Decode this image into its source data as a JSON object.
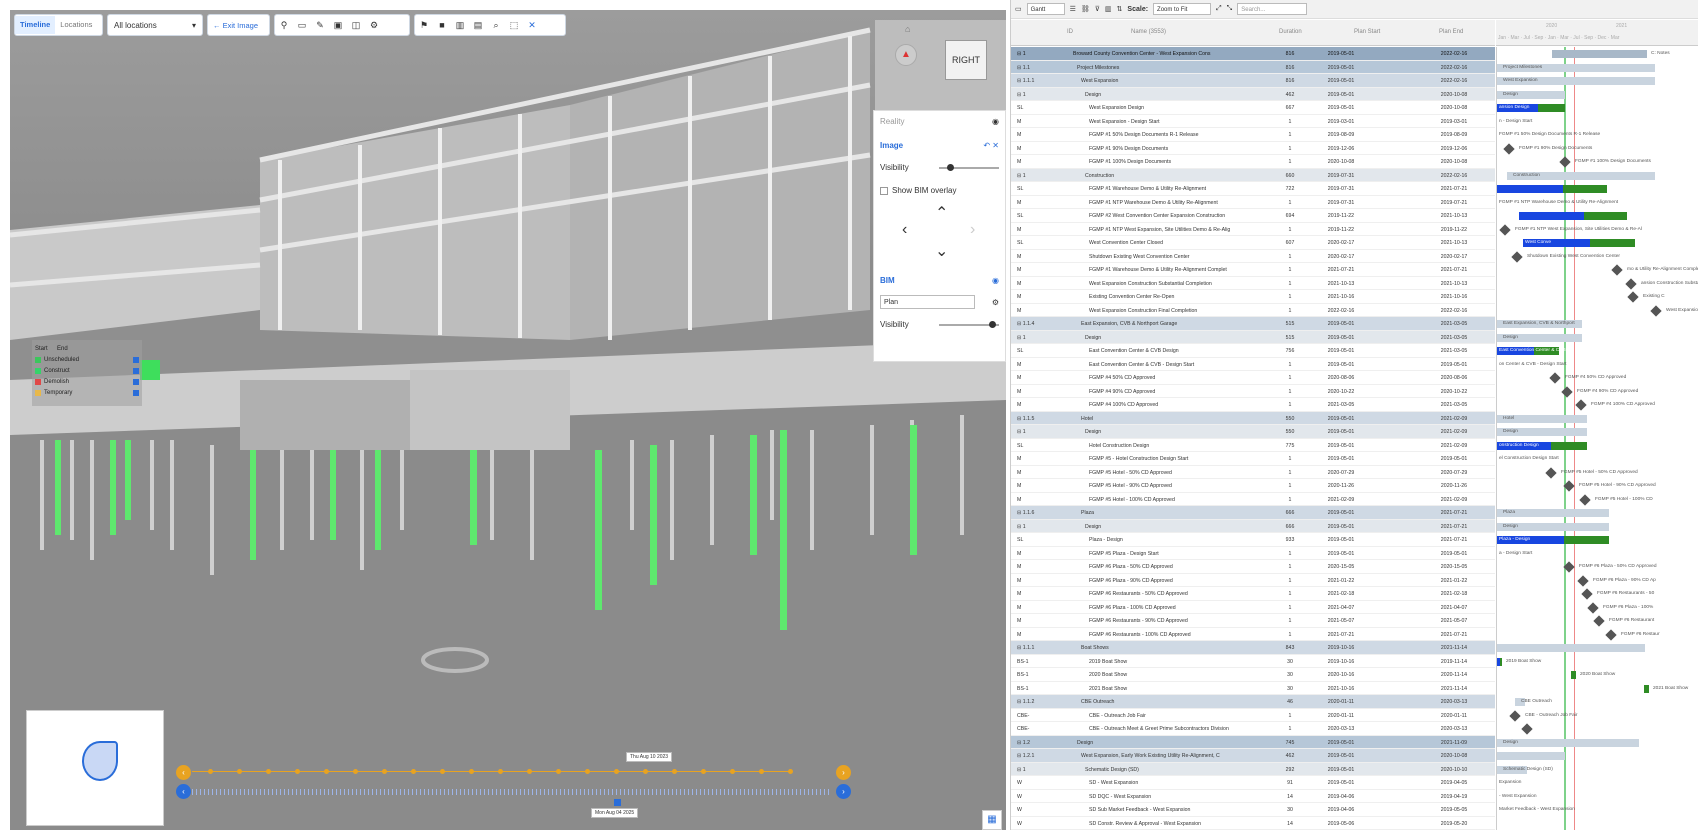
{
  "viewer": {
    "tabs": [
      {
        "label": "Timeline",
        "active": true
      },
      {
        "label": "Locations",
        "active": false
      }
    ],
    "location_select": "All locations",
    "exit_image": "Exit Image",
    "nav_cube_label": "RIGHT",
    "panel": {
      "reality": "Reality",
      "image": "Image",
      "visibility": "Visibility",
      "show_bim_overlay": "Show BIM overlay",
      "bim": "BIM",
      "plan_select": "Plan",
      "visibility2": "Visibility"
    },
    "legend": {
      "start": "Start",
      "end": "End",
      "items": [
        {
          "label": "Unscheduled",
          "color": "#3cc65c"
        },
        {
          "label": "Construct",
          "color": "#36d36a"
        },
        {
          "label": "Demolish",
          "color": "#e04848"
        },
        {
          "label": "Temporary",
          "color": "#e8b84a"
        }
      ]
    },
    "timeline": {
      "top_date": "Thu Aug 10 2023",
      "bottom_date": "Mon Aug 04 2025"
    }
  },
  "gantt": {
    "toolbar": {
      "view": "Gantt",
      "scale_label": "Scale:",
      "scale_value": "Zoom to Fit",
      "search_placeholder": "Search..."
    },
    "columns": {
      "id": "ID",
      "name": "Name (3553)",
      "duration": "Duration",
      "plan_start": "Plan Start",
      "plan_end": "Plan End"
    },
    "years": [
      "2020",
      "2021"
    ],
    "months": "Jan · Mar · Jul · Sep · Jan · Mar · Jul · Sep · Dec · Mar",
    "rows": [
      {
        "s": 0,
        "id": "⊟ 1",
        "name": "Broward County Convention Center - West Expansion Cons",
        "dur": "816",
        "ps": "2019-05-01",
        "pe": "2022-02-16",
        "bar": {
          "t": "pbar",
          "a": 55,
          "b": 150
        },
        "txt": "C: Notes"
      },
      {
        "s": 1,
        "id": "⊟ 1.1",
        "name": "Project Milestones",
        "dur": "816",
        "ps": "2019-05-01",
        "pe": "2022-02-16",
        "bar": {
          "t": "sum",
          "a": 0,
          "b": 158
        },
        "txt": "Project Milestones"
      },
      {
        "s": 2,
        "id": "⊟ 1.1.1",
        "name": "West Expansion",
        "dur": "816",
        "ps": "2019-05-01",
        "pe": "2022-02-16",
        "bar": {
          "t": "sum",
          "a": 0,
          "b": 158
        },
        "txt": "West Expansion"
      },
      {
        "s": 3,
        "id": "⊟ 1",
        "name": "Design",
        "dur": "462",
        "ps": "2019-05-01",
        "pe": "2020-10-08",
        "bar": {
          "t": "sum",
          "a": 0,
          "b": 68
        },
        "txt": "Design"
      },
      {
        "s": 4,
        "id": "SL",
        "name": "West Expansion Design",
        "dur": "667",
        "ps": "2019-05-01",
        "pe": "2020-10-08",
        "bar": {
          "t": "blue",
          "a": 0,
          "b": 68
        },
        "txt": "ansion Design"
      },
      {
        "s": 4,
        "id": "M",
        "name": "West Expansion - Design Start",
        "dur": "1",
        "ps": "2019-03-01",
        "pe": "2019-03-01",
        "txt": "n - Design Start"
      },
      {
        "s": 4,
        "id": "M",
        "name": "FGMP #1 50% Design Documents R-1 Release",
        "dur": "1",
        "ps": "2019-08-09",
        "pe": "2019-08-09",
        "txt": "FGMP #1 50% Design Documents R-1 Release"
      },
      {
        "s": 4,
        "id": "M",
        "name": "FGMP #1 90% Design Documents",
        "dur": "1",
        "ps": "2019-12-06",
        "pe": "2019-12-06",
        "dia": 8,
        "txt": "FGMP #1 90% Design Documents"
      },
      {
        "s": 4,
        "id": "M",
        "name": "FGMP #1 100% Design Documents",
        "dur": "1",
        "ps": "2020-10-08",
        "pe": "2020-10-08",
        "dia": 64,
        "txt": "FGMP #1 100% Design Documents"
      },
      {
        "s": 3,
        "id": "⊟ 1",
        "name": "Construction",
        "dur": "660",
        "ps": "2019-07-31",
        "pe": "2022-02-16",
        "bar": {
          "t": "sum",
          "a": 10,
          "b": 158
        },
        "txt": "Construction"
      },
      {
        "s": 4,
        "id": "SL",
        "name": "FGMP #1 Warehouse Demo & Utility Re-Alignment",
        "dur": "722",
        "ps": "2019-07-31",
        "pe": "2021-07-21",
        "bar": {
          "t": "blue",
          "a": 0,
          "b": 110
        }
      },
      {
        "s": 4,
        "id": "M",
        "name": "FGMP #1 NTP Warehouse Demo & Utility Re-Alignment",
        "dur": "1",
        "ps": "2019-07-31",
        "pe": "2019-07-21",
        "txt": "FGMP #1 NTP Warehouse Demo & Utility Re-Alignment"
      },
      {
        "s": 4,
        "id": "SL",
        "name": "FGMP #2 West Convention Center Expansion Construction",
        "dur": "694",
        "ps": "2019-11-22",
        "pe": "2021-10-13",
        "bar": {
          "t": "blue",
          "a": 22,
          "b": 130
        }
      },
      {
        "s": 4,
        "id": "M",
        "name": "FGMP #1 NTP West Expansion, Site Utilities Demo & Re-Alig",
        "dur": "1",
        "ps": "2019-11-22",
        "pe": "2019-11-22",
        "dia": 4,
        "txt": "FGMP #1 NTP West Expansion, Site Utilities Demo & Re-Al"
      },
      {
        "s": 4,
        "id": "SL",
        "name": "West Convention Center Closed",
        "dur": "607",
        "ps": "2020-02-17",
        "pe": "2021-10-13",
        "bar": {
          "t": "blue",
          "a": 26,
          "b": 138
        },
        "txt": "West Conve"
      },
      {
        "s": 4,
        "id": "M",
        "name": "Shutdown Existing West Convention Center",
        "dur": "1",
        "ps": "2020-02-17",
        "pe": "2020-02-17",
        "dia": 16,
        "txt": "Shutdown Existing West Convention Center"
      },
      {
        "s": 4,
        "id": "M",
        "name": "FGMP #1 Warehouse Demo & Utility Re-Alignment Complet",
        "dur": "1",
        "ps": "2021-07-21",
        "pe": "2021-07-21",
        "dia": 116,
        "txt": "mo & Utility Re-Alignment Complete"
      },
      {
        "s": 4,
        "id": "M",
        "name": "West Expansion Construction Substantial Completion",
        "dur": "1",
        "ps": "2021-10-13",
        "pe": "2021-10-13",
        "dia": 130,
        "txt": "ansion Construction Substantial Completion"
      },
      {
        "s": 4,
        "id": "M",
        "name": "Existing Convention Center Re-Open",
        "dur": "1",
        "ps": "2021-10-16",
        "pe": "2021-10-16",
        "dia": 132,
        "txt": "Existing C"
      },
      {
        "s": 4,
        "id": "M",
        "name": "West Expansion Construction Final Completion",
        "dur": "1",
        "ps": "2022-02-16",
        "pe": "2022-02-16",
        "dia": 155,
        "txt": "West Expansion Construction Final Completion"
      },
      {
        "s": 2,
        "id": "⊟ 1.1.4",
        "name": "East Expansion, CVB & Northport Garage",
        "dur": "515",
        "ps": "2019-05-01",
        "pe": "2021-03-05",
        "bar": {
          "t": "sum",
          "a": 0,
          "b": 85
        },
        "txt": "East Expansion, CVB & Northport"
      },
      {
        "s": 3,
        "id": "⊟ 1",
        "name": "Design",
        "dur": "515",
        "ps": "2019-05-01",
        "pe": "2021-03-05",
        "bar": {
          "t": "sum",
          "a": 0,
          "b": 85
        },
        "txt": "Design"
      },
      {
        "s": 4,
        "id": "SL",
        "name": "East Convention Center & CVB Design",
        "dur": "756",
        "ps": "2019-05-01",
        "pe": "2021-03-05",
        "bar": {
          "t": "blue",
          "a": 0,
          "b": 62
        },
        "txt": "East Convention Center & CVB"
      },
      {
        "s": 4,
        "id": "M",
        "name": "East Convention Center & CVB - Design Start",
        "dur": "1",
        "ps": "2019-05-01",
        "pe": "2019-05-01",
        "txt": "on Center & CVB - Design Start"
      },
      {
        "s": 4,
        "id": "M",
        "name": "FGMP #4 50% CD Approved",
        "dur": "1",
        "ps": "2020-08-06",
        "pe": "2020-08-06",
        "dia": 54,
        "txt": "FGMP #4 50% CD Approved"
      },
      {
        "s": 4,
        "id": "M",
        "name": "FGMP #4 90% CD Approved",
        "dur": "1",
        "ps": "2020-10-22",
        "pe": "2020-10-22",
        "dia": 66,
        "txt": "FGMP #4 90% CD Approved"
      },
      {
        "s": 4,
        "id": "M",
        "name": "FGMP #4 100% CD Approved",
        "dur": "1",
        "ps": "2021-03-05",
        "pe": "2021-03-05",
        "dia": 80,
        "txt": "FGMP #4 100% CD Approved"
      },
      {
        "s": 2,
        "id": "⊟ 1.1.5",
        "name": "Hotel",
        "dur": "550",
        "ps": "2019-05-01",
        "pe": "2021-02-09",
        "bar": {
          "t": "sum",
          "a": 0,
          "b": 90
        },
        "txt": "Hotel"
      },
      {
        "s": 3,
        "id": "⊟ 1",
        "name": "Design",
        "dur": "550",
        "ps": "2019-05-01",
        "pe": "2021-02-09",
        "bar": {
          "t": "sum",
          "a": 0,
          "b": 90
        },
        "txt": "Design"
      },
      {
        "s": 4,
        "id": "SL",
        "name": "Hotel Construction Design",
        "dur": "775",
        "ps": "2019-05-01",
        "pe": "2021-02-09",
        "bar": {
          "t": "blue",
          "a": 0,
          "b": 90
        },
        "txt": "onstruction Design"
      },
      {
        "s": 4,
        "id": "M",
        "name": "FGMP #5 - Hotel Construction Design Start",
        "dur": "1",
        "ps": "2019-05-01",
        "pe": "2019-05-01",
        "txt": "el Construction Design Start"
      },
      {
        "s": 4,
        "id": "M",
        "name": "FGMP #5 Hotel - 50% CD Approved",
        "dur": "1",
        "ps": "2020-07-29",
        "pe": "2020-07-29",
        "dia": 50,
        "txt": "FGMP #5 Hotel - 50% CD Approved"
      },
      {
        "s": 4,
        "id": "M",
        "name": "FGMP #5 Hotel - 90% CD Approved",
        "dur": "1",
        "ps": "2020-11-26",
        "pe": "2020-11-26",
        "dia": 68,
        "txt": "FGMP #5 Hotel - 90% CD Approved"
      },
      {
        "s": 4,
        "id": "M",
        "name": "FGMP #5 Hotel - 100% CD Approved",
        "dur": "1",
        "ps": "2021-02-09",
        "pe": "2021-02-09",
        "dia": 84,
        "txt": "FGMP #5 Hotel - 100% CD"
      },
      {
        "s": 2,
        "id": "⊟ 1.1.6",
        "name": "Plaza",
        "dur": "666",
        "ps": "2019-05-01",
        "pe": "2021-07-21",
        "bar": {
          "t": "sum",
          "a": 0,
          "b": 112
        },
        "txt": "Plaza"
      },
      {
        "s": 3,
        "id": "⊟ 1",
        "name": "Design",
        "dur": "666",
        "ps": "2019-05-01",
        "pe": "2021-07-21",
        "bar": {
          "t": "sum",
          "a": 0,
          "b": 112
        },
        "txt": "Design"
      },
      {
        "s": 4,
        "id": "SL",
        "name": "Plaza - Design",
        "dur": "933",
        "ps": "2019-05-01",
        "pe": "2021-07-21",
        "bar": {
          "t": "blue",
          "a": 0,
          "b": 112
        },
        "txt": "Plaza - Design"
      },
      {
        "s": 4,
        "id": "M",
        "name": "FGMP #5 Plaza - Design Start",
        "dur": "1",
        "ps": "2019-05-01",
        "pe": "2019-05-01",
        "txt": "a - Design Start"
      },
      {
        "s": 4,
        "id": "M",
        "name": "FGMP #6 Plaza - 50% CD Approved",
        "dur": "1",
        "ps": "2020-15-05",
        "pe": "2020-15-05",
        "dia": 68,
        "txt": "FGMP #6 Plaza - 50% CD Approved"
      },
      {
        "s": 4,
        "id": "M",
        "name": "FGMP #6 Plaza - 90% CD Approved",
        "dur": "1",
        "ps": "2021-01-22",
        "pe": "2021-01-22",
        "dia": 82,
        "txt": "FGMP #6 Plaza - 90% CD Ap"
      },
      {
        "s": 4,
        "id": "M",
        "name": "FGMP #6 Restaurants - 50% CD Approved",
        "dur": "1",
        "ps": "2021-02-18",
        "pe": "2021-02-18",
        "dia": 86,
        "txt": "FGMP #6 Restaurants - 50"
      },
      {
        "s": 4,
        "id": "M",
        "name": "FGMP #6 Plaza - 100% CD Approved",
        "dur": "1",
        "ps": "2021-04-07",
        "pe": "2021-04-07",
        "dia": 92,
        "txt": "FGMP #6 Plaza - 100%"
      },
      {
        "s": 4,
        "id": "M",
        "name": "FGMP #6 Restaurants - 90% CD Approved",
        "dur": "1",
        "ps": "2021-05-07",
        "pe": "2021-05-07",
        "dia": 98,
        "txt": "FGMP #6 Restaurant"
      },
      {
        "s": 4,
        "id": "M",
        "name": "FGMP #6 Restaurants - 100% CD Approved",
        "dur": "1",
        "ps": "2021-07-21",
        "pe": "2021-07-21",
        "dia": 110,
        "txt": "FGMP #6 Restaur"
      },
      {
        "s": 2,
        "id": "⊟ 1.1.1",
        "name": "Boat Shows",
        "dur": "843",
        "ps": "2019-10-16",
        "pe": "2021-11-14",
        "bar": {
          "t": "sum",
          "a": 0,
          "b": 148
        }
      },
      {
        "s": 4,
        "id": "BS-1",
        "name": "2019 Boat Show",
        "dur": "30",
        "ps": "2019-10-16",
        "pe": "2019-11-14",
        "bar": {
          "t": "blue",
          "a": 0,
          "b": 5
        },
        "txt": "2019 Boat Show"
      },
      {
        "s": 4,
        "id": "BS-1",
        "name": "2020 Boat Show",
        "dur": "30",
        "ps": "2020-10-16",
        "pe": "2020-11-14",
        "bar": {
          "t": "green",
          "a": 74,
          "b": 79
        },
        "txt": "2020 Boat Show"
      },
      {
        "s": 4,
        "id": "BS-1",
        "name": "2021 Boat Show",
        "dur": "30",
        "ps": "2021-10-16",
        "pe": "2021-11-14",
        "bar": {
          "t": "green",
          "a": 147,
          "b": 152
        },
        "txt": "2021 Boat Show"
      },
      {
        "s": 2,
        "id": "⊟ 1.1.2",
        "name": "CBE Outreach",
        "dur": "46",
        "ps": "2020-01-11",
        "pe": "2020-03-13",
        "bar": {
          "t": "sum",
          "a": 18,
          "b": 28
        },
        "txt": "CBE Outreach"
      },
      {
        "s": 4,
        "id": "CBE-",
        "name": "CBE - Outreach Job Fair",
        "dur": "1",
        "ps": "2020-01-11",
        "pe": "2020-01-11",
        "dia": 14,
        "txt": "CBE - Outreach Job Fair"
      },
      {
        "s": 4,
        "id": "CBE-",
        "name": "CBE - Outreach Meet & Greet Prime Subcontractors Division",
        "dur": "1",
        "ps": "2020-03-13",
        "pe": "2020-03-13",
        "dia": 26,
        "txt": ""
      },
      {
        "s": 1,
        "id": "⊟ 1.2",
        "name": "Design",
        "dur": "745",
        "ps": "2019-05-01",
        "pe": "2021-11-09",
        "bar": {
          "t": "sum",
          "a": 0,
          "b": 142
        },
        "txt": "Design"
      },
      {
        "s": 2,
        "id": "⊟ 1.2.1",
        "name": "West Expansion, Early Work Existing Utility Re-Alignment, C",
        "dur": "462",
        "ps": "2019-05-01",
        "pe": "2020-10-08",
        "bar": {
          "t": "sum",
          "a": 0,
          "b": 68
        }
      },
      {
        "s": 3,
        "id": "⊟ 1",
        "name": "Schematic Design (SD)",
        "dur": "292",
        "ps": "2019-05-01",
        "pe": "2020-10-10",
        "bar": {
          "t": "sum",
          "a": 0,
          "b": 30
        },
        "txt": "Schematic Design (SD)"
      },
      {
        "s": 4,
        "id": "W",
        "name": "SD - West Expansion",
        "dur": "91",
        "ps": "2019-05-01",
        "pe": "2019-04-05",
        "txt": "Expansion"
      },
      {
        "s": 4,
        "id": "W",
        "name": "SD DQC - West Expansion",
        "dur": "14",
        "ps": "2019-04-06",
        "pe": "2019-04-19",
        "txt": "- West Expansion"
      },
      {
        "s": 4,
        "id": "W",
        "name": "SD Sub Market Feedback - West Expansion",
        "dur": "30",
        "ps": "2019-04-06",
        "pe": "2019-05-05",
        "txt": "Market Feedback - West Expansion"
      },
      {
        "s": 4,
        "id": "W",
        "name": "SD Constr. Review & Approval - West Expansion",
        "dur": "14",
        "ps": "2019-05-06",
        "pe": "2019-05-20",
        "txt": ""
      }
    ]
  }
}
